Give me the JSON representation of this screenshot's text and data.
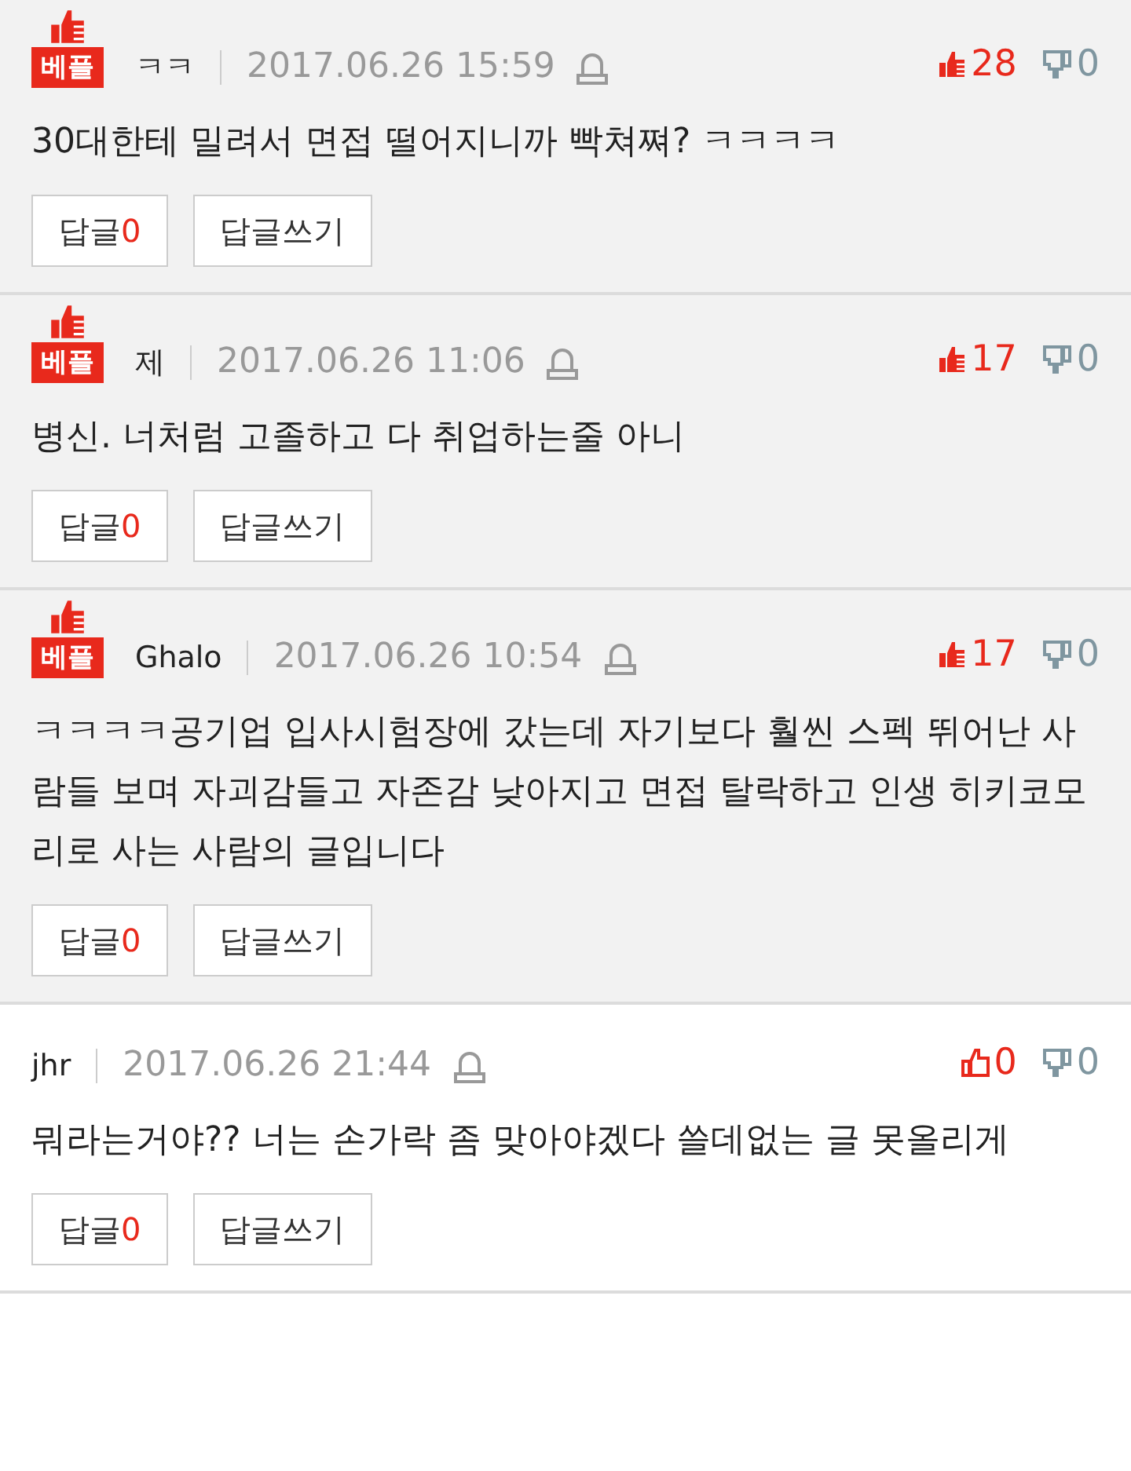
{
  "comments": [
    {
      "best": true,
      "badge": "베플",
      "author": "ㅋㅋ",
      "date": "2017.06.26 15:59",
      "likes": "28",
      "dislikes": "0",
      "text": "30대한테 밀려서 면접 떨어지니까 빡쳐쪄? ㅋㅋㅋㅋ",
      "reply_label": "답글",
      "reply_count": "0",
      "write_label": "답글쓰기"
    },
    {
      "best": true,
      "badge": "베플",
      "author": "제",
      "date": "2017.06.26 11:06",
      "likes": "17",
      "dislikes": "0",
      "text": "병신. 너처럼 고졸하고 다 취업하는줄 아니",
      "reply_label": "답글",
      "reply_count": "0",
      "write_label": "답글쓰기"
    },
    {
      "best": true,
      "badge": "베플",
      "author": "Ghalo",
      "date": "2017.06.26 10:54",
      "likes": "17",
      "dislikes": "0",
      "text": "ㅋㅋㅋㅋ공기업 입사시험장에 갔는데 자기보다 훨씬 스펙 뛰어난 사람들 보며 자괴감들고 자존감 낮아지고 면접 탈락하고 인생 히키코모리로 사는 사람의 글입니다",
      "reply_label": "답글",
      "reply_count": "0",
      "write_label": "답글쓰기"
    },
    {
      "best": false,
      "author": "jhr",
      "date": "2017.06.26 21:44",
      "likes": "0",
      "dislikes": "0",
      "text": "뭐라는거야?? 너는 손가락 좀 맞아야겠다 쓸데없는 글 못올리게",
      "reply_label": "답글",
      "reply_count": "0",
      "write_label": "답글쓰기"
    }
  ]
}
